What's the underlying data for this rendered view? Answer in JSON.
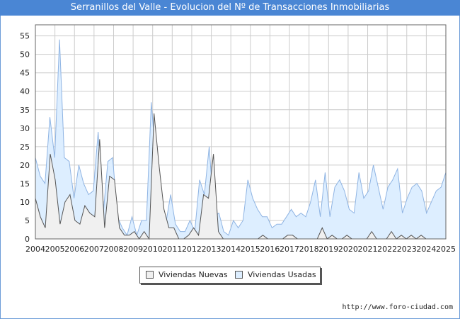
{
  "title": "Serranillos del Valle - Evolucion del Nº de Transacciones Inmobiliarias",
  "footer": "http://www.foro-ciudad.com",
  "colors": {
    "header": "#4a86d4",
    "nuevas_line": "#555555",
    "nuevas_fill": "#f0f0f0",
    "usadas_line": "#8fb4e3",
    "usadas_fill": "#ddeeff",
    "grid": "#cccccc"
  },
  "chart_data": {
    "type": "area",
    "title": "Serranillos del Valle - Evolucion del Nº de Transacciones Inmobiliarias",
    "x_labels": [
      "2004",
      "2005",
      "2006",
      "2007",
      "2008",
      "2009",
      "2010",
      "2011",
      "2012",
      "2013",
      "2014",
      "2015",
      "2016",
      "2017",
      "2018",
      "2019",
      "2020",
      "2021",
      "2022",
      "2023",
      "2024",
      "2025"
    ],
    "x_unit": "quarter",
    "ylim": [
      0,
      58
    ],
    "y_ticks": [
      0,
      5,
      10,
      15,
      20,
      25,
      30,
      35,
      40,
      45,
      50,
      55
    ],
    "grid": true,
    "legend_position": "bottom",
    "series": [
      {
        "name": "Viviendas Nuevas",
        "values": [
          11,
          6,
          3,
          23,
          16,
          4,
          10,
          12,
          5,
          4,
          9,
          7,
          6,
          27,
          3,
          17,
          16,
          3,
          1,
          1,
          2,
          0,
          2,
          0,
          34,
          20,
          8,
          3,
          3,
          0,
          0,
          1,
          3,
          1,
          12,
          11,
          23,
          2,
          0,
          0,
          0,
          0,
          0,
          0,
          0,
          0,
          1,
          0,
          0,
          0,
          0,
          1,
          1,
          0,
          0,
          0,
          0,
          0,
          3,
          0,
          1,
          0,
          0,
          1,
          0,
          0,
          0,
          0,
          2,
          0,
          0,
          0,
          2,
          0,
          1,
          0,
          1,
          0,
          1,
          0,
          0,
          0,
          0,
          0
        ]
      },
      {
        "name": "Viviendas Usadas",
        "values": [
          22,
          17,
          15,
          33,
          22,
          54,
          22,
          21,
          11,
          20,
          15,
          12,
          13,
          29,
          6,
          21,
          22,
          6,
          3,
          1,
          6,
          1,
          5,
          5,
          37,
          20,
          10,
          4,
          12,
          4,
          2,
          2,
          5,
          2,
          16,
          12,
          25,
          6,
          7,
          2,
          1,
          5,
          3,
          5,
          16,
          11,
          8,
          6,
          6,
          3,
          4,
          4,
          6,
          8,
          6,
          7,
          6,
          10,
          16,
          6,
          18,
          6,
          14,
          16,
          13,
          8,
          7,
          18,
          11,
          13,
          20,
          14,
          8,
          14,
          16,
          19,
          7,
          11,
          14,
          15,
          13,
          7,
          10,
          13,
          14,
          18
        ]
      }
    ]
  }
}
